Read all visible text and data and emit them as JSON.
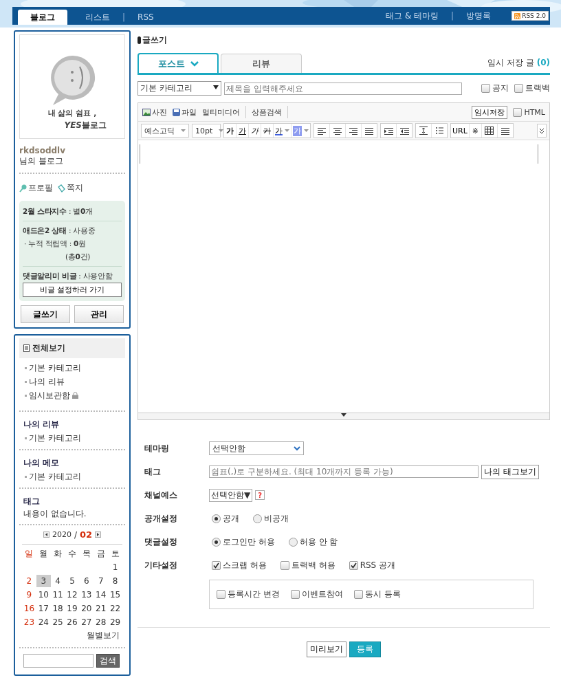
{
  "nav": {
    "tabs": [
      {
        "label": "블로그",
        "selected": true
      },
      {
        "label": "리스트",
        "selected": false
      },
      {
        "label": "RSS",
        "selected": false
      }
    ],
    "separator_left": "|",
    "links": [
      "태그 & 테마링",
      "방명록"
    ],
    "separator_right": "|",
    "rss_badge": "RSS 2.0"
  },
  "sidebar": {
    "logo_line": "내 삶의 쉼표 ,",
    "logo_brand": "YES",
    "logo_suffix": "블로그",
    "user_id": "rkdsoddlv",
    "blog_name": "님의 블로그",
    "profile_links": [
      {
        "kind": "profile",
        "label": "프로필"
      },
      {
        "kind": "message",
        "label": "쪽지"
      }
    ],
    "stats": [
      [
        {
          "kind": "labeled",
          "text": "**2월 스타지수** : 별**0**개"
        }
      ],
      [
        {
          "kind": "labeled",
          "text": "**애드온2 상태** : 사용중"
        },
        {
          "kind": "plain",
          "text": "· 누적 적립액 : **0**원"
        },
        {
          "kind": "indent",
          "text": "(총**0**건)"
        }
      ],
      [
        {
          "kind": "labeled",
          "text": "**댓글알리미 비글** : 사용안함"
        }
      ]
    ],
    "settings_button": "비글 설정하러 가기",
    "buttons": [
      "글쓰기",
      "관리"
    ],
    "all_label": "전체보기",
    "categories": [
      {
        "label": "기본 카테고리",
        "locked": false
      },
      {
        "label": "나의 리뷰",
        "locked": false
      },
      {
        "label": "임시보관함",
        "locked": true
      }
    ],
    "sections": [
      {
        "title": "나의 리뷰",
        "items": [
          "기본 카테고리"
        ]
      },
      {
        "title": "나의 메모",
        "items": [
          "기본 카테고리"
        ]
      },
      {
        "title": "태그",
        "text": "내용이 없습니다."
      }
    ],
    "calendar": {
      "year": "2020",
      "separator": "/",
      "month": "02",
      "weekdays": [
        "일",
        "월",
        "화",
        "수",
        "목",
        "금",
        "토"
      ],
      "weeks": [
        [
          {
            "day": "1",
            "selected": false
          }
        ],
        [
          {
            "day": "2",
            "selected": false
          },
          {
            "day": "3",
            "selected": true
          },
          {
            "day": "4",
            "selected": false
          },
          {
            "day": "5",
            "selected": false
          },
          {
            "day": "6",
            "selected": false
          },
          {
            "day": "7",
            "selected": false
          },
          {
            "day": "8",
            "selected": false
          }
        ],
        [
          {
            "day": "9",
            "selected": false
          },
          {
            "day": "10",
            "selected": false
          },
          {
            "day": "11",
            "selected": false
          },
          {
            "day": "12",
            "selected": false
          },
          {
            "day": "13",
            "selected": false
          },
          {
            "day": "14",
            "selected": false
          },
          {
            "day": "15",
            "selected": false
          }
        ],
        [
          {
            "day": "16",
            "selected": false
          },
          {
            "day": "17",
            "selected": false
          },
          {
            "day": "18",
            "selected": false
          },
          {
            "day": "19",
            "selected": false
          },
          {
            "day": "20",
            "selected": false
          },
          {
            "day": "21",
            "selected": false
          },
          {
            "day": "22",
            "selected": false
          }
        ],
        [
          {
            "day": "23",
            "selected": false
          },
          {
            "day": "24",
            "selected": false
          },
          {
            "day": "25",
            "selected": false
          },
          {
            "day": "26",
            "selected": false
          },
          {
            "day": "27",
            "selected": false
          },
          {
            "day": "28",
            "selected": false
          },
          {
            "day": "29",
            "selected": false
          }
        ]
      ],
      "monthly_link": "월별보기"
    },
    "search_button": "검색"
  },
  "main": {
    "heading": "글쓰기",
    "tabs": [
      {
        "label": "포스트",
        "selected": true
      },
      {
        "label": "리뷰",
        "selected": false
      }
    ],
    "drafts_label": "임시 저장 글",
    "drafts_count": "(0)",
    "category_select": "기본 카테고리",
    "title_placeholder": "제목을 입력해주세요",
    "options": [
      {
        "label": "공지",
        "checked": false
      },
      {
        "label": "트랙백",
        "checked": false
      }
    ],
    "attach": [
      {
        "label": "사진"
      },
      {
        "kind": "file",
        "label": "파일"
      },
      {
        "kind": "plain",
        "label": "멀티미디어"
      }
    ],
    "product_search": "상품검색",
    "temp_save": "임시저장",
    "html": {
      "label": "HTML",
      "checked": false
    },
    "font": "예스고딕",
    "size": "10pt",
    "format_groups": [
      [
        {
          "kind": "bold",
          "text": "가"
        },
        {
          "kind": "underline",
          "text": "가"
        },
        {
          "kind": "italic",
          "text": "가"
        },
        {
          "kind": "strike",
          "text": "가"
        },
        {
          "kind": "color",
          "text": "가"
        },
        {
          "kind": "highlight",
          "text": "가"
        }
      ],
      [
        {
          "kind": "align-left"
        },
        {
          "kind": "align-center"
        },
        {
          "kind": "align-right"
        },
        {
          "kind": "justify"
        }
      ],
      [
        {
          "kind": "indent"
        },
        {
          "kind": "outdent"
        }
      ],
      [
        {
          "kind": "line-spacing"
        },
        {
          "kind": "list"
        }
      ],
      [
        {
          "kind": "text",
          "text": "URL"
        },
        {
          "kind": "text",
          "text": "※"
        },
        {
          "kind": "table"
        },
        {
          "kind": "rule"
        }
      ]
    ],
    "form": [
      {
        "kind": "select",
        "label": "테마링",
        "value": "선택안함"
      },
      {
        "kind": "tags",
        "label": "태그",
        "placeholder": "쉼표(,)로 구분하세요. (최대 10개까지 등록 가능)",
        "button": "나의 태그보기"
      },
      {
        "kind": "small-select",
        "label": "채널예스",
        "value": "선택안함▼",
        "help": "?"
      },
      {
        "kind": "radio",
        "label": "공개설정",
        "choices": [
          {
            "label": "공개",
            "selected": true
          },
          {
            "label": "비공개",
            "selected": false
          }
        ]
      },
      {
        "kind": "radio",
        "label": "댓글설정",
        "choices": [
          {
            "label": "로그인만 허용",
            "selected": true
          },
          {
            "label": "허용 안 함",
            "selected": false
          }
        ]
      },
      {
        "kind": "check",
        "label": "기타설정",
        "choices": [
          {
            "label": "스크랩 허용",
            "checked": true
          },
          {
            "label": "트랙백 허용",
            "checked": false
          },
          {
            "label": "RSS 공개",
            "checked": true
          }
        ]
      },
      {
        "kind": "check-box",
        "choices": [
          {
            "label": "등록시간 변경",
            "checked": false
          },
          {
            "label": "이벤트참여",
            "checked": false
          },
          {
            "label": "동시 등록",
            "checked": false
          }
        ]
      }
    ],
    "preview_button": "미리보기",
    "submit_button": "등록"
  }
}
